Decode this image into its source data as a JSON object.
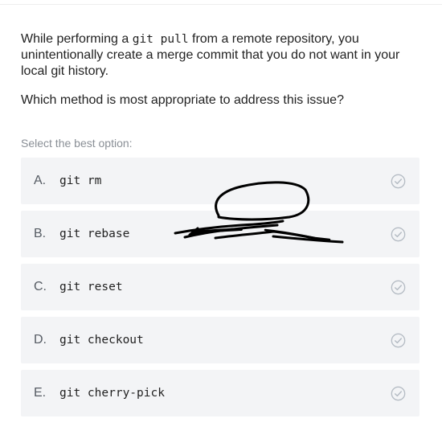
{
  "question": {
    "line1_prefix": "While performing a ",
    "line1_code": "git pull",
    "line1_suffix": " from a remote repository, you unintentionally create a merge commit that you do not want in your local git history.",
    "line2": "Which method is most appropriate to address this issue?"
  },
  "hint": "Select the best option:",
  "options": [
    {
      "letter": "A.",
      "text": "git rm"
    },
    {
      "letter": "B.",
      "text": "git rebase"
    },
    {
      "letter": "C.",
      "text": "git reset"
    },
    {
      "letter": "D.",
      "text": "git checkout"
    },
    {
      "letter": "E.",
      "text": "git cherry-pick"
    }
  ],
  "icons": {
    "option_check": "check-circle-icon",
    "drawing": "hand-drawn-scribble"
  },
  "colors": {
    "option_bg": "#f3f4f6",
    "check": "#b5bcc4",
    "hint": "#8a8f96",
    "ink": "#000000"
  }
}
